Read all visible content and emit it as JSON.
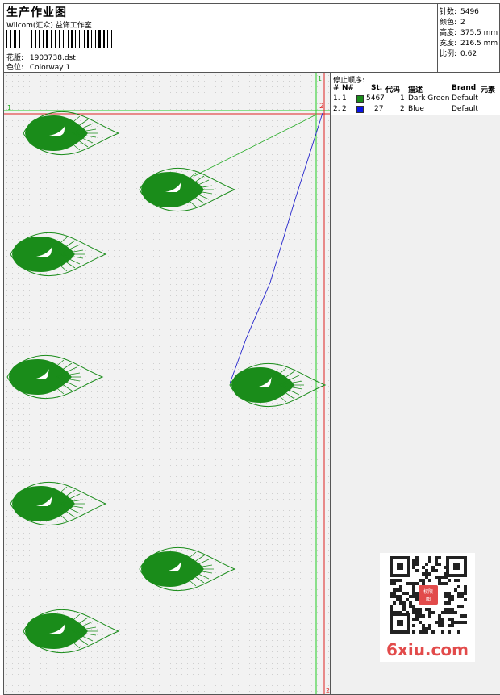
{
  "header": {
    "title": "生产作业图",
    "studio": "Wilcom(汇众) 益饰工作室",
    "design_label": "花版:",
    "design_value": "1903738.dst",
    "colorway_label": "色位:",
    "colorway_value": "Colorway 1"
  },
  "stats": {
    "stitches_label": "针数:",
    "stitches_value": "5496",
    "colors_label": "颜色:",
    "colors_value": "2",
    "height_label": "高度:",
    "height_value": "375.5 mm",
    "width_label": "宽度:",
    "width_value": "216.5 mm",
    "scale_label": "比例:",
    "scale_value": "0.62"
  },
  "canvas": {
    "marker_1_top": "1",
    "marker_1_left": "1",
    "marker_2": "2",
    "marker_2_bottom": "2"
  },
  "color_table": {
    "title": "停止顺序:",
    "columns": {
      "num": "#",
      "needle": "N#",
      "stitches": "St.",
      "code": "代码",
      "desc": "描述",
      "brand": "Brand",
      "element": "元素"
    },
    "rows": [
      {
        "num": "1.",
        "needle": "1",
        "color": "#1a8c1a",
        "stitches": "5467",
        "code": "1",
        "desc": "Dark Green",
        "brand": "Default"
      },
      {
        "num": "2.",
        "needle": "2",
        "color": "#0a14e6",
        "stitches": "27",
        "code": "2",
        "desc": "Blue",
        "brand": "Default"
      }
    ]
  },
  "colors": {
    "leaf_fill": "#1a8c1a",
    "leaf_outline": "#1a8c1a",
    "guide_green": "#22cc22",
    "guide_red": "#dd2222",
    "jump_blue": "#2222cc",
    "watermark_red": "#e24b4b"
  },
  "watermark": {
    "text": "6xiu.com",
    "seal": "权限图"
  }
}
